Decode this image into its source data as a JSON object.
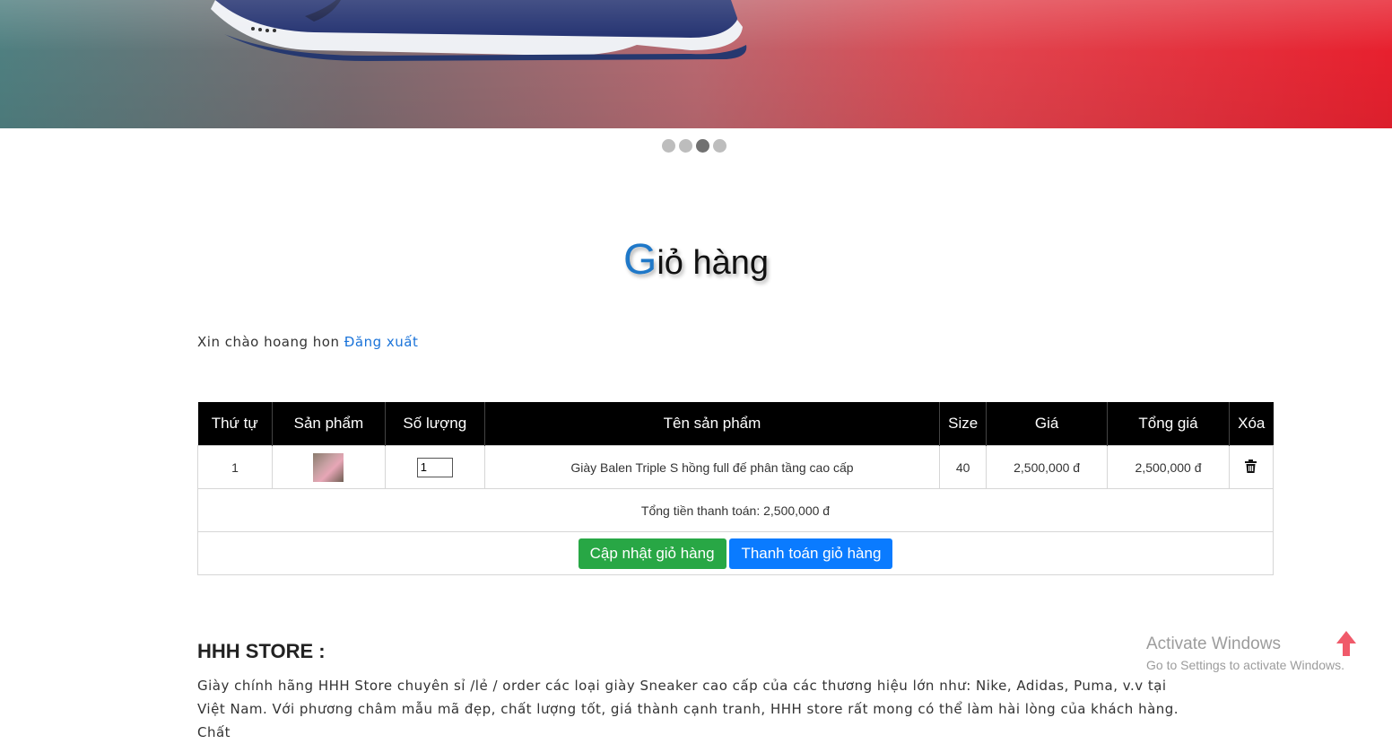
{
  "banner": {
    "image": "sneaker-banner",
    "colors": {
      "left": "#4f7f80",
      "right": "#e7202e"
    }
  },
  "carousel": {
    "dot_count": 4,
    "active_index": 2
  },
  "cart": {
    "title_first": "G",
    "title_rest": "iỏ hàng",
    "greeting": "Xin chào hoang hon",
    "logout": "Đăng xuất",
    "headers": [
      "Thứ tự",
      "Sản phẩm",
      "Số lượng",
      "Tên sản phẩm",
      "Size",
      "Giá",
      "Tổng giá",
      "Xóa"
    ],
    "rows": [
      {
        "index": "1",
        "qty": "1",
        "name": "Giày Balen Triple S hồng full đế phân tầng cao cấp",
        "size": "40",
        "price": "2,500,000 đ",
        "total": "2,500,000 đ"
      }
    ],
    "grand_total": "Tổng tiền thanh toán: 2,500,000 đ",
    "update_btn": "Cập nhật giỏ hàng",
    "checkout_btn": "Thanh toán giỏ hàng"
  },
  "store": {
    "title": "HHH STORE :",
    "desc": "Giày chính hãng HHH Store chuyên sỉ /lẻ / order các loại giày Sneaker cao cấp của các thương hiệu lớn như: Nike, Adidas, Puma, v.v tại Việt Nam. Với phương châm mẫu mã đẹp, chất lượng tốt, giá thành cạnh tranh, HHH store rất mong có thể làm hài lòng của khách hàng. Chất"
  },
  "windows": {
    "line1": "Activate Windows",
    "line2": "Go to Settings to activate Windows."
  },
  "icons": {
    "delete": "trash-icon",
    "scroll_top": "arrow-up-icon"
  },
  "accent": {
    "green": "#28a745",
    "blue": "#0a7bff",
    "title_g": "#1f78c8"
  }
}
